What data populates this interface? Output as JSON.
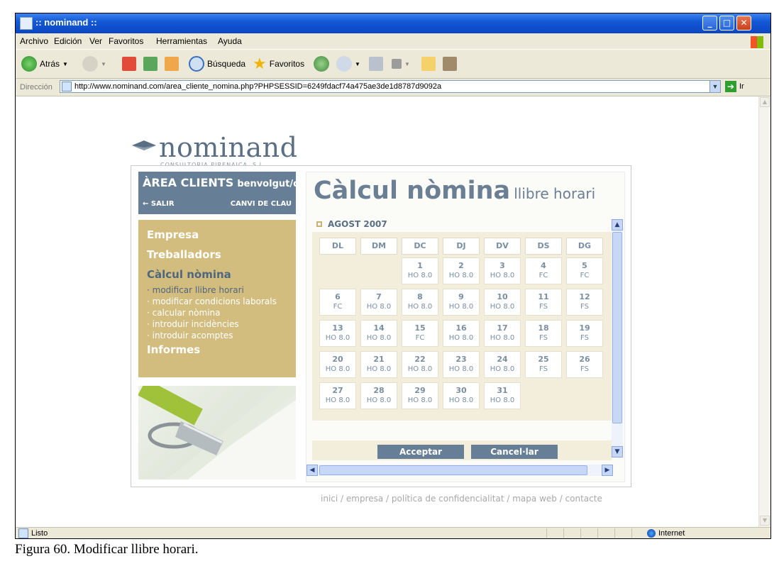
{
  "window": {
    "title": ":: nominand ::"
  },
  "menu": [
    "Archivo",
    "Edición",
    "Ver",
    "Favoritos",
    "Herramientas",
    "Ayuda"
  ],
  "toolbar": {
    "back": "Atrás",
    "search": "Búsqueda",
    "favorites": "Favoritos"
  },
  "address": {
    "label": "Dirección",
    "url": "http://www.nominand.com/area_cliente_nomina.php?PHPSESSID=6249fdacf74a475ae3de1d8787d9092a",
    "go": "Ir"
  },
  "logo": {
    "name": "nominand",
    "subtitle": "CONSULTORIA PIRENAICA, S.L."
  },
  "clients": {
    "title": "ÀREA CLIENTS",
    "greeting": "benvolgut/da,",
    "logout": "← SALIR",
    "change_key": "CANVI DE CLAU"
  },
  "nav": {
    "empresa": "Empresa",
    "treballadors": "Treballadors",
    "calcul": "Càlcul nòmina",
    "sub": [
      "· modificar llibre horari",
      "· modificar condicions laborals",
      "· calcular nòmina",
      "· introduir incidències",
      "· introduir acomptes"
    ],
    "informes": "Informes"
  },
  "page": {
    "title": "Càlcul nòmina",
    "subtitle": "llibre horari",
    "month": "AGOST 2007"
  },
  "calendar": {
    "headers": [
      "DL",
      "DM",
      "DC",
      "DJ",
      "DV",
      "DS",
      "DG"
    ],
    "days": [
      {
        "d": "1",
        "h": "HO 8.0"
      },
      {
        "d": "2",
        "h": "HO 8.0"
      },
      {
        "d": "3",
        "h": "HO 8.0"
      },
      {
        "d": "4",
        "h": "FC"
      },
      {
        "d": "5",
        "h": "FC"
      },
      {
        "d": "6",
        "h": "FC"
      },
      {
        "d": "7",
        "h": "HO 8.0"
      },
      {
        "d": "8",
        "h": "HO 8.0"
      },
      {
        "d": "9",
        "h": "HO 8.0"
      },
      {
        "d": "10",
        "h": "HO 8.0"
      },
      {
        "d": "11",
        "h": "FS"
      },
      {
        "d": "12",
        "h": "FS"
      },
      {
        "d": "13",
        "h": "HO 8.0"
      },
      {
        "d": "14",
        "h": "HO 8.0"
      },
      {
        "d": "15",
        "h": "FC"
      },
      {
        "d": "16",
        "h": "HO 8.0"
      },
      {
        "d": "17",
        "h": "HO 8.0"
      },
      {
        "d": "18",
        "h": "FS"
      },
      {
        "d": "19",
        "h": "FS"
      },
      {
        "d": "20",
        "h": "HO 8.0"
      },
      {
        "d": "21",
        "h": "HO 8.0"
      },
      {
        "d": "22",
        "h": "HO 8.0"
      },
      {
        "d": "23",
        "h": "HO 8.0"
      },
      {
        "d": "24",
        "h": "HO 8.0"
      },
      {
        "d": "25",
        "h": "FS"
      },
      {
        "d": "26",
        "h": "FS"
      },
      {
        "d": "27",
        "h": "HO 8.0"
      },
      {
        "d": "28",
        "h": "HO 8.0"
      },
      {
        "d": "29",
        "h": "HO 8.0"
      },
      {
        "d": "30",
        "h": "HO 8.0"
      },
      {
        "d": "31",
        "h": "HO 8.0"
      }
    ]
  },
  "buttons": {
    "accept": "Acceptar",
    "cancel": "Cancel·lar"
  },
  "footer": "inici / empresa / política de confidencialitat / mapa web / contacte",
  "status": {
    "text": "Listo",
    "zone": "Internet"
  },
  "caption": "Figura 60. Modificar llibre horari.",
  "colors": {
    "title_bar": "#0b46c2",
    "panel_blue": "#667f96",
    "nav_gold": "#d2bd7f",
    "calendar_bg": "#f2eedb"
  }
}
